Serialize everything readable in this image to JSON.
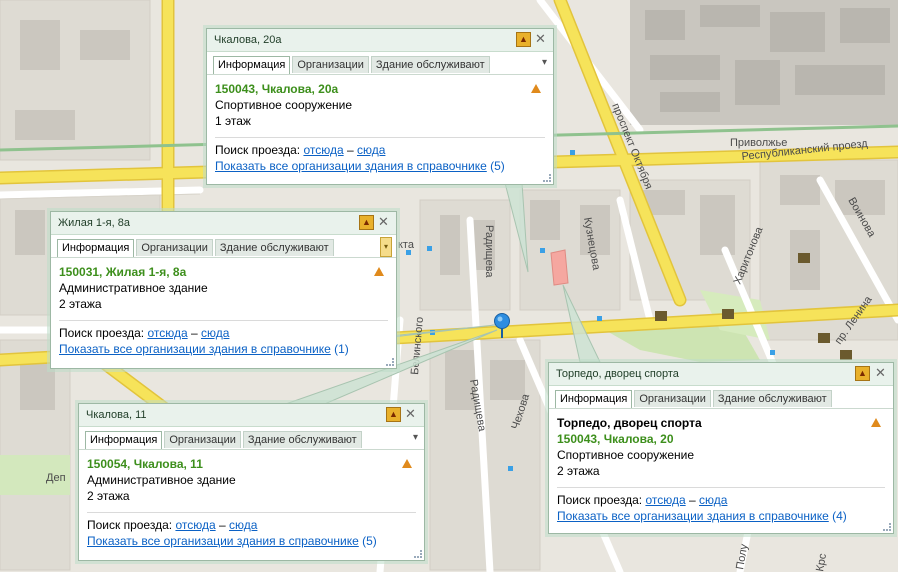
{
  "map": {
    "streets": {
      "prospekt_oktyabrya": "проспект Октября",
      "respublikansky": "Республиканский проезд",
      "privolzhye": "Приволжье",
      "radishcheva": "Радищева",
      "radishcheva2": "Радищева",
      "kuznetsova": "Кузнецова",
      "kharitonova": "Харитонова",
      "voinova": "Воинова",
      "lenina": "пр. Ленина",
      "belinskogo": "Белинского",
      "chekhova": "Чехова",
      "kta": "кта",
      "dep": "Деп",
      "polu": "Полу",
      "krs": "Крс"
    },
    "colors": {
      "road": "#f6e35a",
      "road_edge": "#e2c43c",
      "park": "#cfe6b4",
      "block": "#dcd8cf",
      "building": "#c7c3bb"
    }
  },
  "popups": {
    "chkalova20a": {
      "title": "Чкалова, 20а",
      "tabs": [
        "Информация",
        "Организации",
        "Здание обслуживают"
      ],
      "address": "150043, Чкалова, 20а",
      "type": "Спортивное сооружение",
      "floors": "1 этаж",
      "route_label": "Поиск проезда:",
      "from": "отсюда",
      "dash": "–",
      "to": "сюда",
      "all_orgs": "Показать все организации здания в справочнике",
      "count": "(5)"
    },
    "zhilaya": {
      "title": "Жилая 1-я, 8а",
      "tabs": [
        "Информация",
        "Организации",
        "Здание обслуживают"
      ],
      "address": "150031, Жилая 1-я, 8а",
      "type": "Административное здание",
      "floors": "2 этажа",
      "route_label": "Поиск проезда:",
      "from": "отсюда",
      "dash": "–",
      "to": "сюда",
      "all_orgs": "Показать все организации здания в справочнике",
      "count": "(1)"
    },
    "chkalova11": {
      "title": "Чкалова, 11",
      "tabs": [
        "Информация",
        "Организации",
        "Здание обслуживают"
      ],
      "address": "150054, Чкалова, 11",
      "type": "Административное здание",
      "floors": "2 этажа",
      "route_label": "Поиск проезда:",
      "from": "отсюда",
      "dash": "–",
      "to": "сюда",
      "all_orgs": "Показать все организации здания в справочнике",
      "count": "(5)"
    },
    "torpedo": {
      "title": "Торпедо, дворец спорта",
      "tabs": [
        "Информация",
        "Организации",
        "Здание обслуживают"
      ],
      "name": "Торпедо, дворец спорта",
      "address": "150043, Чкалова, 20",
      "type": "Спортивное сооружение",
      "floors": "2 этажа",
      "route_label": "Поиск проезда:",
      "from": "отсюда",
      "dash": "–",
      "to": "сюда",
      "all_orgs": "Показать все организации здания в справочнике",
      "count": "(4)"
    }
  }
}
